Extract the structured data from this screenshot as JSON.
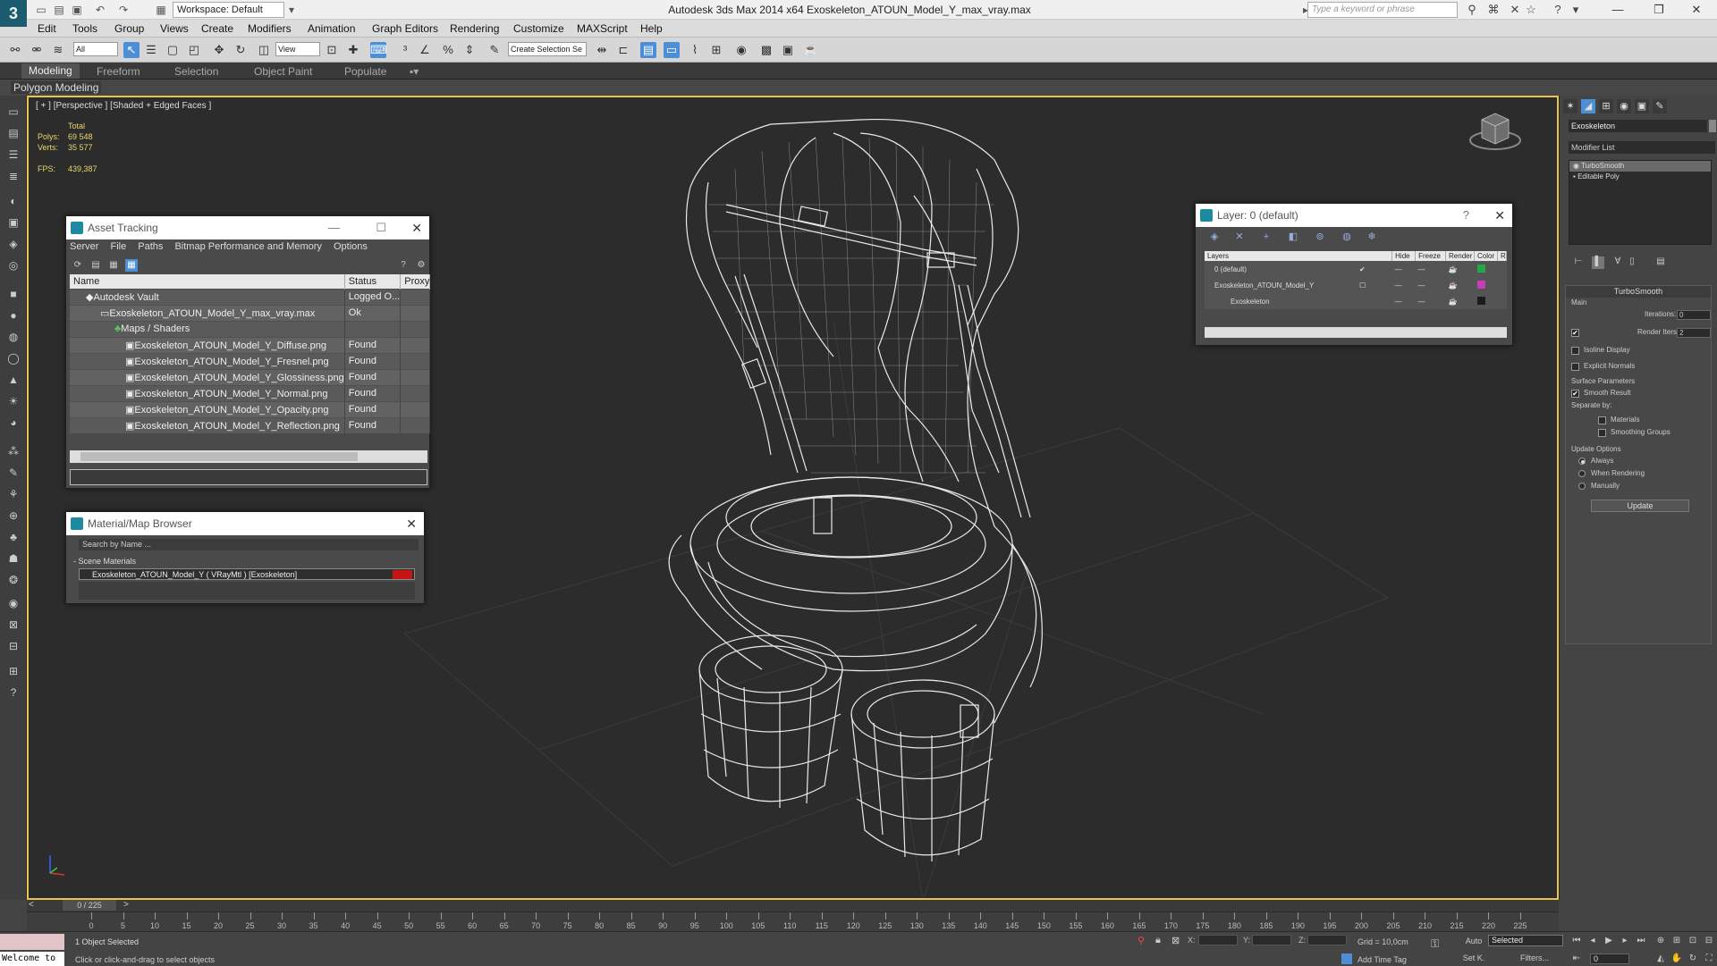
{
  "app": {
    "logo": "3",
    "title": "Autodesk 3ds Max  2014 x64     Exoskeleton_ATOUN_Model_Y_max_vray.max",
    "workspace": "Workspace: Default",
    "search_placeholder": "Type a keyword or phrase"
  },
  "menu": [
    "Edit",
    "Tools",
    "Group",
    "Views",
    "Create",
    "Modifiers",
    "Animation",
    "Graph Editors",
    "Rendering",
    "Customize",
    "MAXScript",
    "Help"
  ],
  "toolbar": {
    "filter_value": "All",
    "refcoord_value": "View",
    "named_selection": "Create Selection Se"
  },
  "ribbon": {
    "tabs": [
      "Modeling",
      "Freeform",
      "Selection",
      "Object Paint",
      "Populate"
    ],
    "active_tab": "Modeling",
    "panel_label": "Polygon Modeling"
  },
  "viewport": {
    "label": "[ + ] [Perspective ] [Shaded + Edged Faces ]",
    "stats": {
      "header": "Total",
      "polys_label": "Polys:",
      "polys": "69 548",
      "verts_label": "Verts:",
      "verts": "35 577",
      "fps_label": "FPS:",
      "fps": "439,387"
    },
    "accent_color": "#e9c34e"
  },
  "asset_tracking": {
    "title": "Asset Tracking",
    "menu": [
      "Server",
      "File",
      "Paths",
      "Bitmap Performance and Memory",
      "Options"
    ],
    "columns": [
      "Name",
      "Status",
      "Proxy"
    ],
    "rows": [
      {
        "name": "Autodesk Vault",
        "status": "Logged O..."
      },
      {
        "name": "Exoskeleton_ATOUN_Model_Y_max_vray.max",
        "status": "Ok"
      },
      {
        "name": "Maps / Shaders",
        "status": ""
      },
      {
        "name": "Exoskeleton_ATOUN_Model_Y_Diffuse.png",
        "status": "Found"
      },
      {
        "name": "Exoskeleton_ATOUN_Model_Y_Fresnel.png",
        "status": "Found"
      },
      {
        "name": "Exoskeleton_ATOUN_Model_Y_Glossiness.png",
        "status": "Found"
      },
      {
        "name": "Exoskeleton_ATOUN_Model_Y_Normal.png",
        "status": "Found"
      },
      {
        "name": "Exoskeleton_ATOUN_Model_Y_Opacity.png",
        "status": "Found"
      },
      {
        "name": "Exoskeleton_ATOUN_Model_Y_Reflection.png",
        "status": "Found"
      }
    ]
  },
  "material_browser": {
    "title": "Material/Map Browser",
    "search_placeholder": "Search by Name ...",
    "section": "- Scene Materials",
    "item": "Exoskeleton_ATOUN_Model_Y ( VRayMtl ) [Exoskeleton]",
    "swatch_color": "#c41414"
  },
  "layer_dialog": {
    "title": "Layer: 0 (default)",
    "help": "?",
    "columns": [
      "Layers",
      "Hide",
      "Freeze",
      "Render",
      "Color",
      "R"
    ],
    "rows": [
      {
        "name": "0 (default)",
        "check": "✔",
        "hide": "—",
        "freeze": "—",
        "color": "#23a84c"
      },
      {
        "name": "Exoskeleton_ATOUN_Model_Y",
        "check": "☐",
        "hide": "—",
        "freeze": "—",
        "color": "#c83cb8"
      },
      {
        "name": "Exoskeleton",
        "check": "",
        "hide": "—",
        "freeze": "—",
        "color": "#1c1c1c"
      }
    ]
  },
  "command_panel": {
    "object_name": "Exoskeleton",
    "modifier_list": "Modifier List",
    "stack": [
      "TurboSmooth",
      "Editable Poly"
    ],
    "turbosmooth": {
      "title": "TurboSmooth",
      "main": "Main",
      "iterations_label": "Iterations:",
      "iterations": "0",
      "render_iters_label": "Render Iters:",
      "render_iters": "2",
      "isoline": "Isoline Display",
      "explicit": "Explicit Normals",
      "surface": "Surface Parameters",
      "smooth_result": "Smooth Result",
      "separate": "Separate by:",
      "materials": "Materials",
      "smoothing_groups": "Smoothing Groups",
      "update_options": "Update Options",
      "always": "Always",
      "when_rendering": "When Rendering",
      "manually": "Manually",
      "update": "Update"
    }
  },
  "timeline": {
    "position": "0 / 225",
    "ticks": [
      "0",
      "5",
      "10",
      "15",
      "20",
      "25",
      "30",
      "35",
      "40",
      "45",
      "50",
      "55",
      "60",
      "65",
      "70",
      "75",
      "80",
      "85",
      "90",
      "95",
      "100",
      "105",
      "110",
      "115",
      "120",
      "125",
      "130",
      "135",
      "140",
      "145",
      "150",
      "155",
      "160",
      "165",
      "170",
      "175",
      "180",
      "185",
      "190",
      "195",
      "200",
      "205",
      "210",
      "215",
      "220",
      "225"
    ]
  },
  "status": {
    "welcome": "Welcome to",
    "selected": "1 Object Selected",
    "hint": "Click or click-and-drag to select objects",
    "x": "X:",
    "y": "Y:",
    "z": "Z:",
    "grid": "Grid = 10,0cm",
    "add_time_tag": "Add Time Tag",
    "auto": "Auto",
    "setk": "Set K.",
    "selection": "Selected",
    "filters": "Filters...",
    "frame": "0"
  }
}
